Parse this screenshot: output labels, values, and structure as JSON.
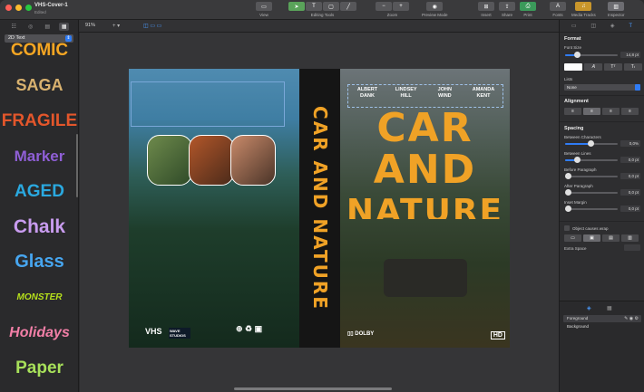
{
  "window": {
    "title": "VHS-Cover-1",
    "subtitle": "Edited"
  },
  "toolbar": {
    "view": "View",
    "editing_tools": "Editing Tools",
    "zoom": "Zoom",
    "preview": "Preview Mode",
    "insert": "Insert",
    "share": "Share",
    "print": "Print",
    "fonts": "Fonts",
    "media": "Media Tracks",
    "inspector": "Inspector"
  },
  "subbar": {
    "zoom_value": "91%"
  },
  "left_panel": {
    "selector": "2D Text",
    "styles": [
      {
        "label": "COMIC",
        "color": "#f5a623"
      },
      {
        "label": "SAGA",
        "color": "#d9b26f"
      },
      {
        "label": "FRAGILE",
        "color": "#e3562b"
      },
      {
        "label": "Marker",
        "color": "#8f5fd6"
      },
      {
        "label": "AGED",
        "color": "#2aa9e0"
      },
      {
        "label": "Chalk",
        "color": "#c99cf0"
      },
      {
        "label": "Glass",
        "color": "#47a6f0"
      },
      {
        "label": "MONSTER",
        "color": "#b6e01b"
      },
      {
        "label": "Holidays",
        "color": "#f27fa7"
      },
      {
        "label": "Paper",
        "color": "#a7e05a"
      }
    ]
  },
  "cover": {
    "spine_title": "CAR AND NATURE",
    "front_title_lines": [
      "CAR",
      "AND",
      "NATURE"
    ],
    "names": [
      {
        "first": "ALBERT",
        "last": "DANK"
      },
      {
        "first": "LINDSEY",
        "last": "HILL"
      },
      {
        "first": "JOHN",
        "last": "WIND"
      },
      {
        "first": "AMANDA",
        "last": "KENT"
      }
    ],
    "vhs_logo": "VHS",
    "wave_label": "WAVE STUDIOS",
    "hd_badge": "HD",
    "dolby_label": "DOLBY"
  },
  "inspector": {
    "format": "Format",
    "font_size_label": "Font Size",
    "font_size_value": "14,8 pt",
    "font_size_fraction": 0.22,
    "lists_label": "Lists",
    "lists_value": "None",
    "alignment": "Alignment",
    "spacing": "Spacing",
    "between_chars": "Between Characters",
    "between_chars_value": "0,0%",
    "between_lines": "Between Lines",
    "between_lines_value": "0,0 pt",
    "before_paragraph": "Before Paragraph",
    "before_paragraph_value": "0,0 pt",
    "after_paragraph": "After Paragraph",
    "after_paragraph_value": "0,0 pt",
    "inset_margin": "Inset Margin",
    "inset_margin_value": "0,0 pt",
    "object_wrap": "Object causes wrap",
    "extra_space": "Extra Space",
    "layers": [
      "Foreground",
      "Background"
    ]
  },
  "colors": {
    "accent": "#2f7cf6",
    "title_orange": "#f0a226"
  }
}
